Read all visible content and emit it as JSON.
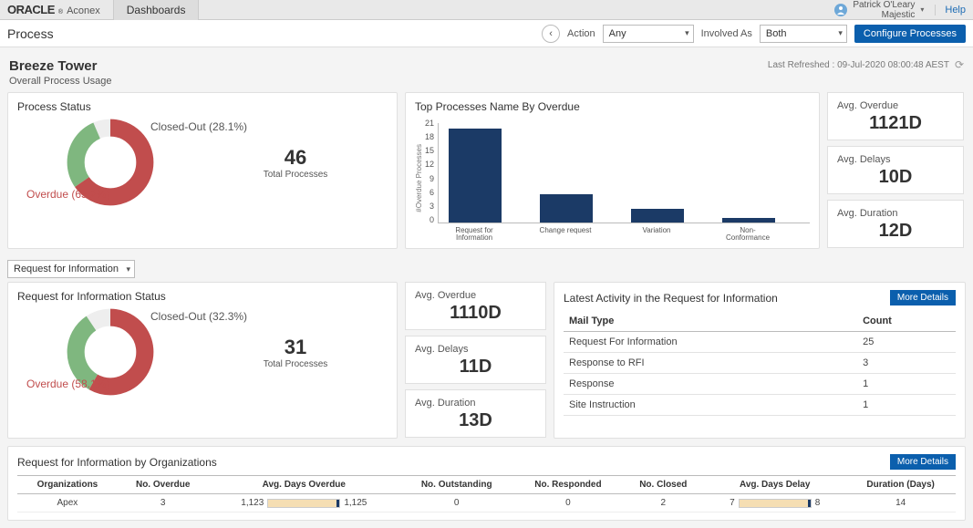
{
  "header": {
    "brand_main": "ORACLE",
    "brand_sub": "Aconex",
    "tab_dashboards": "Dashboards",
    "user_name": "Patrick O'Leary",
    "user_org": "Majestic",
    "help": "Help"
  },
  "toolbar": {
    "process": "Process",
    "action_label": "Action",
    "action_value": "Any",
    "involved_label": "Involved As",
    "involved_value": "Both",
    "configure": "Configure Processes"
  },
  "page": {
    "title": "Breeze Tower",
    "subtitle": "Overall Process Usage",
    "refresh": "Last Refreshed : 09-Jul-2020 08:00:48 AEST"
  },
  "processStatus": {
    "title": "Process Status",
    "closed_label": "Closed-Out (28.1%)",
    "overdue_label": "Overdue (65.2%)",
    "total_value": "46",
    "total_label": "Total Processes"
  },
  "topProcesses": {
    "title": "Top Processes Name By Overdue",
    "ylabel": "#Overdue Processes"
  },
  "kpis_top": {
    "overdue_label": "Avg. Overdue",
    "overdue_value": "1121D",
    "delays_label": "Avg. Delays",
    "delays_value": "10D",
    "duration_label": "Avg. Duration",
    "duration_value": "12D"
  },
  "type_select": "Request for Information",
  "rfiStatus": {
    "title": "Request for Information Status",
    "closed_label": "Closed-Out (32.3%)",
    "overdue_label": "Overdue (58.1%)",
    "total_value": "31",
    "total_label": "Total Processes"
  },
  "kpis_mid": {
    "overdue_label": "Avg. Overdue",
    "overdue_value": "1110D",
    "delays_label": "Avg. Delays",
    "delays_value": "11D",
    "duration_label": "Avg. Duration",
    "duration_value": "13D"
  },
  "activity": {
    "title": "Latest Activity in the Request for Information",
    "more": "More Details",
    "col_mail": "Mail Type",
    "col_count": "Count",
    "r0_m": "Request For Information",
    "r0_c": "25",
    "r1_m": "Response to RFI",
    "r1_c": "3",
    "r2_m": "Response",
    "r2_c": "1",
    "r3_m": "Site Instruction",
    "r3_c": "1"
  },
  "org": {
    "title": "Request for Information by Organizations",
    "more": "More Details",
    "c0": "Organizations",
    "c1": "No. Overdue",
    "c2": "Avg. Days Overdue",
    "c3": "No. Outstanding",
    "c4": "No. Responded",
    "c5": "No. Closed",
    "c6": "Avg. Days Delay",
    "c7": "Duration (Days)",
    "r0_0": "Apex",
    "r0_1": "3",
    "r0_2a": "1,123",
    "r0_2b": "1,125",
    "r0_3": "0",
    "r0_4": "0",
    "r0_5": "2",
    "r0_6a": "7",
    "r0_6b": "8",
    "r0_7": "14"
  },
  "chart_data": {
    "type": "bar",
    "categories": [
      "Request for Information",
      "Change request",
      "Variation",
      "Non-Conformance"
    ],
    "values": [
      20,
      6,
      3,
      1
    ],
    "ylabel": "#Overdue Processes",
    "ylim": [
      0,
      21
    ],
    "yticks": [
      0,
      3,
      6,
      9,
      12,
      15,
      18,
      21
    ]
  }
}
